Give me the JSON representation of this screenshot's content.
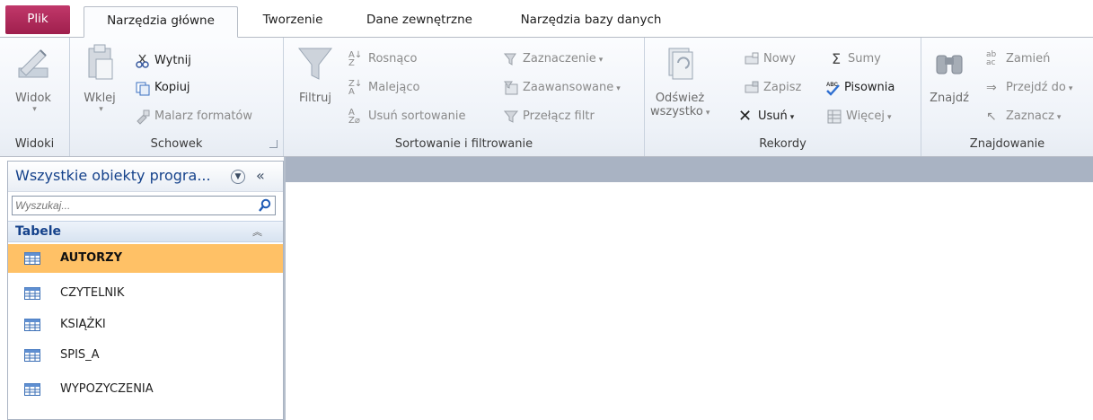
{
  "tabs": {
    "file": "Plik",
    "home": "Narzędzia główne",
    "create": "Tworzenie",
    "external": "Dane zewnętrzne",
    "dbtools": "Narzędzia bazy danych"
  },
  "ribbon": {
    "views": {
      "label": "Widoki",
      "view_btn": "Widok"
    },
    "clipboard": {
      "label": "Schowek",
      "paste": "Wklej",
      "cut": "Wytnij",
      "copy": "Kopiuj",
      "format_painter": "Malarz formatów"
    },
    "sort_filter": {
      "label": "Sortowanie i filtrowanie",
      "filter": "Filtruj",
      "ascending": "Rosnąco",
      "descending": "Malejąco",
      "remove_sort": "Usuń sortowanie",
      "selection": "Zaznaczenie",
      "advanced": "Zaawansowane",
      "toggle_filter": "Przełącz filtr"
    },
    "records": {
      "label": "Rekordy",
      "refresh_line1": "Odśwież",
      "refresh_line2": "wszystko",
      "new": "Nowy",
      "save": "Zapisz",
      "delete": "Usuń",
      "totals": "Sumy",
      "spelling": "Pisownia",
      "more": "Więcej"
    },
    "find": {
      "label": "Znajdowanie",
      "find": "Znajdź",
      "replace": "Zamień",
      "goto": "Przejdź do",
      "select": "Zaznacz"
    }
  },
  "nav": {
    "title": "Wszystkie obiekty progra...",
    "search_placeholder": "Wyszukaj...",
    "group": "Tabele",
    "items": [
      {
        "label": "AUTORZY",
        "selected": true
      },
      {
        "label": "CZYTELNIK",
        "selected": false
      },
      {
        "label": "KSIĄŻKI",
        "selected": false
      },
      {
        "label": "SPIS_A",
        "selected": false
      },
      {
        "label": "WYPOZYCZENIA",
        "selected": false
      }
    ]
  },
  "colors": {
    "file_tab": "#b03060",
    "selected_item": "#ffc166",
    "workspace_bar": "#a9b3c3",
    "nav_title": "#15428b"
  }
}
